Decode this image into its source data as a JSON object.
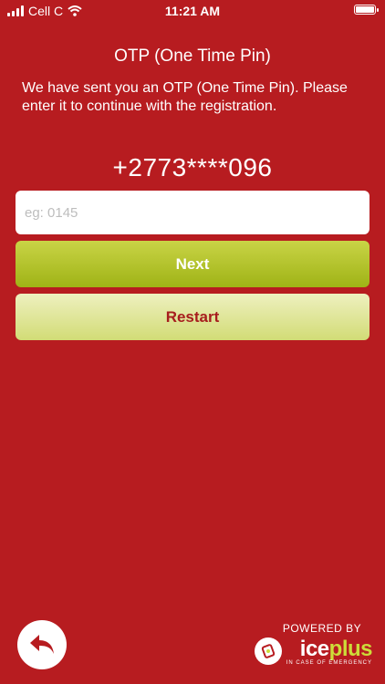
{
  "status_bar": {
    "carrier": "Cell C",
    "time": "11:21 AM"
  },
  "page": {
    "title": "OTP (One Time Pin)",
    "message": "We have sent you an OTP (One Time Pin). Please enter it to continue with the registration.",
    "phone": "+2773****096"
  },
  "otp_input": {
    "placeholder": "eg: 0145",
    "value": ""
  },
  "buttons": {
    "next": "Next",
    "restart": "Restart"
  },
  "footer": {
    "powered_by": "POWERED BY",
    "logo_ice": "ice",
    "logo_plus": "plus",
    "tagline": "IN CASE OF EMERGENCY"
  },
  "colors": {
    "background": "#b71c20",
    "accent_green": "#a4b61a",
    "restart_text": "#a71d1d"
  },
  "icons": {
    "back": "back-arrow-icon",
    "wifi": "wifi-icon",
    "battery": "battery-icon"
  }
}
